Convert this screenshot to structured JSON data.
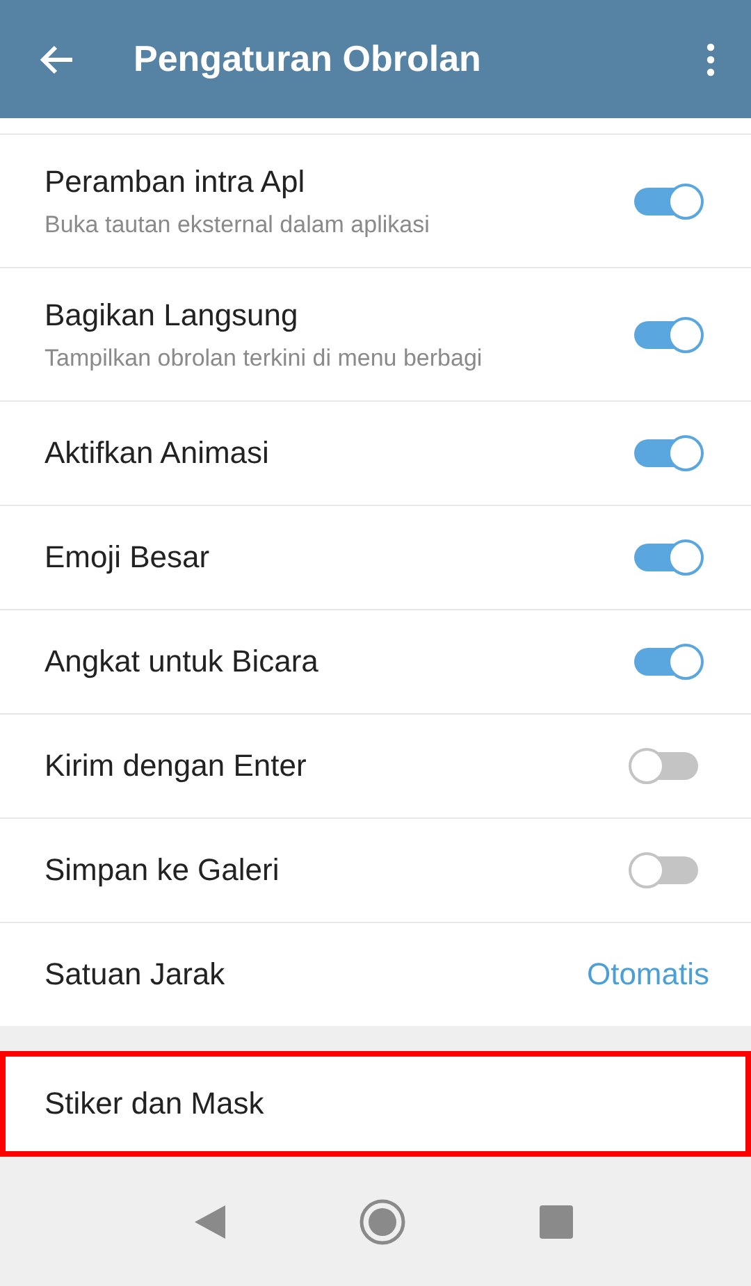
{
  "app_bar": {
    "title": "Pengaturan Obrolan"
  },
  "settings": [
    {
      "kind": "toggle",
      "label": "Peramban intra Apl",
      "subtitle": "Buka tautan eksternal dalam aplikasi",
      "on": true
    },
    {
      "kind": "toggle",
      "label": "Bagikan Langsung",
      "subtitle": "Tampilkan obrolan terkini di menu berbagi",
      "on": true
    },
    {
      "kind": "toggle",
      "label": "Aktifkan Animasi",
      "on": true
    },
    {
      "kind": "toggle",
      "label": "Emoji Besar",
      "on": true
    },
    {
      "kind": "toggle",
      "label": "Angkat untuk Bicara",
      "on": true
    },
    {
      "kind": "toggle",
      "label": "Kirim dengan Enter",
      "on": false
    },
    {
      "kind": "toggle",
      "label": "Simpan ke Galeri",
      "on": false
    },
    {
      "kind": "value",
      "label": "Satuan Jarak",
      "value": "Otomatis"
    }
  ],
  "second_section": [
    {
      "label": "Stiker dan Mask",
      "highlighted": true
    }
  ]
}
